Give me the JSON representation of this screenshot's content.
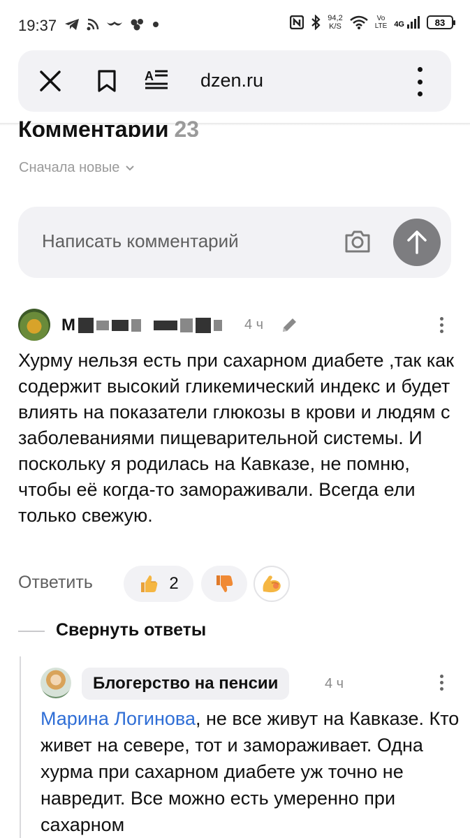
{
  "status_bar": {
    "time": "19:37",
    "net_speed_value": "94,2",
    "net_speed_unit": "K/S",
    "vo": "Vo",
    "lte": "LTE",
    "network": "4G",
    "battery": "83"
  },
  "browser": {
    "url": "dzen.ru"
  },
  "comments_header": {
    "title": "Комментарии",
    "count": "23",
    "sort_label": "Сначала новые"
  },
  "comment_input": {
    "placeholder": "Написать комментарий"
  },
  "comment": {
    "author_initial": "М",
    "time": "4 ч",
    "text": "Хурму нельзя есть при сахарном диабете ,так как содержит высокий гликемический индекс и будет влиять на показатели глюкозы в крови и людям с заболеваниями пищеварительной системы. И поскольку я родилась на Кавказе, не помню, чтобы её когда-то замораживали. Всегда ели только свежую.",
    "reply_label": "Ответить",
    "like_count": "2"
  },
  "collapse_replies_label": "Свернуть ответы",
  "reply": {
    "author": "Блогерство на пенсии",
    "time": "4 ч",
    "mention": "Марина Логинова",
    "text": ", не все живут на Кавказе. Кто живет на севере, тот и замораживает. Одна хурма при сахарном диабете уж точно не навредит. Все можно есть умеренно при сахарном"
  }
}
